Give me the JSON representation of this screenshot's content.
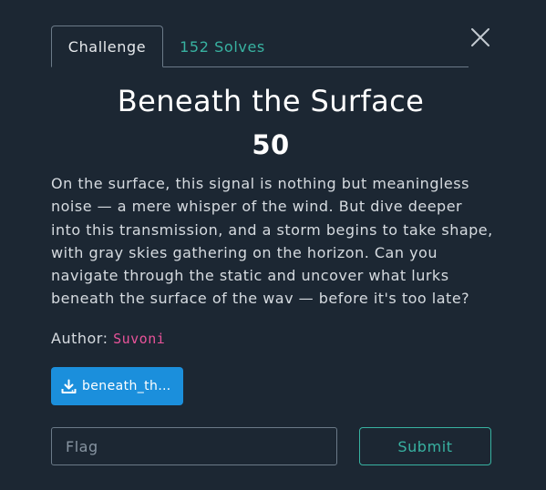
{
  "tabs": [
    {
      "label": "Challenge"
    },
    {
      "label": "152 Solves"
    }
  ],
  "challenge": {
    "title": "Beneath the Surface",
    "points": "50",
    "description": "On the surface, this signal is nothing but meaningless noise — a mere whisper of the wind. But dive deeper into this transmission, and a storm begins to take shape, with gray skies gathering on the horizon. Can you navigate through the static and uncover what lurks beneath the surface of the wav — before it's too late?",
    "author_label": "Author:",
    "author_name": "Suvoni",
    "file_label": "beneath_th…"
  },
  "form": {
    "flag_placeholder": "Flag",
    "flag_value": "",
    "submit_label": "Submit"
  },
  "icons": {
    "close": "close-icon",
    "download": "download-icon"
  },
  "colors": {
    "background": "#1c2733",
    "accent_teal": "#38b2a1",
    "author_pink": "#e8539a",
    "download_blue": "#1b8fdc"
  }
}
